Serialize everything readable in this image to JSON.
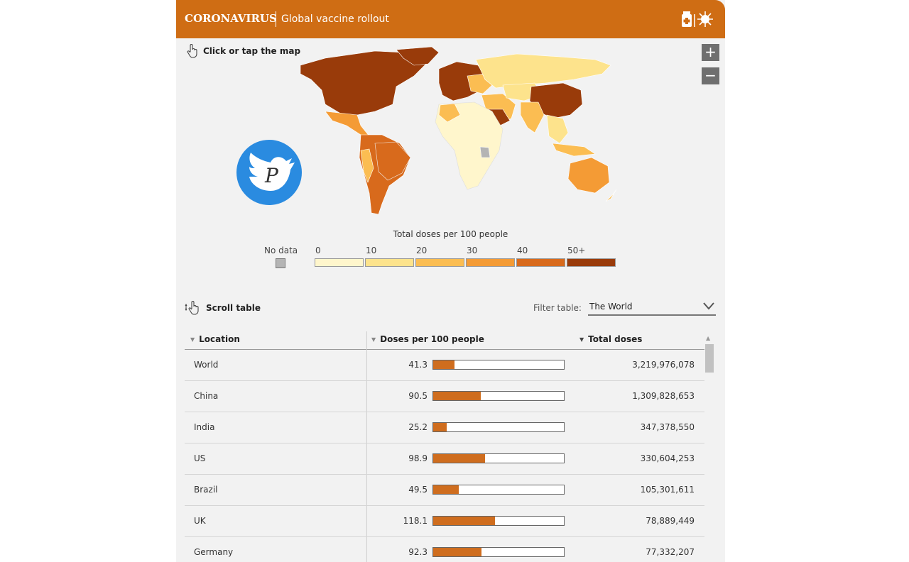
{
  "header": {
    "brand": "CORONAVIRUS",
    "subtitle": "Global vaccine rollout",
    "icon": "vaccine-virus-icon"
  },
  "map": {
    "hint": "Click or tap the map",
    "zoom_in": "+",
    "zoom_out": "−"
  },
  "legend": {
    "title": "Total doses per 100 people",
    "no_data": "No data",
    "ticks": [
      "0",
      "10",
      "20",
      "30",
      "40",
      "50+"
    ],
    "colors": [
      "#fff6cc",
      "#fde38c",
      "#fbbd52",
      "#f49b35",
      "#d86a1c",
      "#993b0a"
    ],
    "no_data_color": "#b4b4b4"
  },
  "table_controls": {
    "scroll_hint": "Scroll table",
    "filter_label": "Filter table:",
    "filter_value": "The World"
  },
  "table": {
    "headers": {
      "location": "Location",
      "doses": "Doses per 100 people",
      "total": "Total doses"
    },
    "bar_max": 250,
    "rows": [
      {
        "location": "World",
        "doses": "41.3",
        "total": "3,219,976,078"
      },
      {
        "location": "China",
        "doses": "90.5",
        "total": "1,309,828,653"
      },
      {
        "location": "India",
        "doses": "25.2",
        "total": "347,378,550"
      },
      {
        "location": "US",
        "doses": "98.9",
        "total": "330,604,253"
      },
      {
        "location": "Brazil",
        "doses": "49.5",
        "total": "105,301,611"
      },
      {
        "location": "UK",
        "doses": "118.1",
        "total": "78,889,449"
      },
      {
        "location": "Germany",
        "doses": "92.3",
        "total": "77,332,207"
      }
    ]
  }
}
